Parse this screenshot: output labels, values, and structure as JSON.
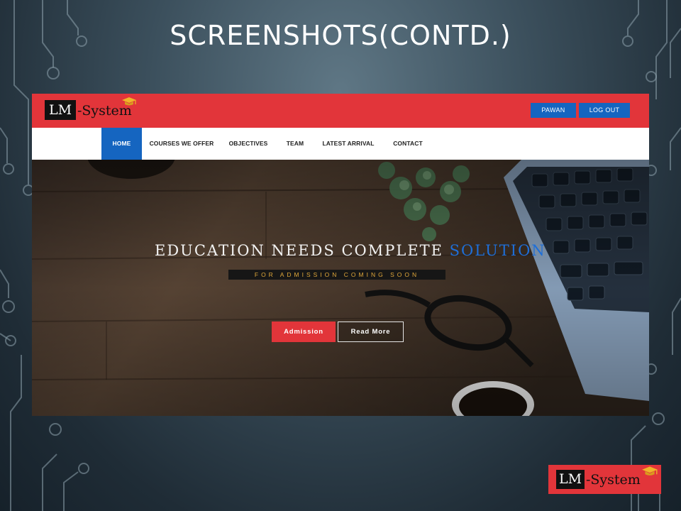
{
  "slide": {
    "title": "SCREENSHOTS(CONTD.)"
  },
  "site": {
    "logo": {
      "lm": "LM",
      "system": "-System"
    },
    "header_buttons": {
      "user": "PAWAN",
      "logout": "LOG OUT"
    },
    "nav": [
      {
        "label": "HOME",
        "active": true
      },
      {
        "label": "COURSES WE OFFER",
        "active": false
      },
      {
        "label": "OBJECTIVES",
        "active": false
      },
      {
        "label": "TEAM",
        "active": false
      },
      {
        "label": "LATEST ARRIVAL",
        "active": false
      },
      {
        "label": "CONTACT",
        "active": false
      }
    ],
    "hero": {
      "title_main": "EDUCATION NEEDS COMPLETE",
      "title_accent": "SOLUTION",
      "subtitle": "FOR ADMISSION COMING SOON",
      "admission_button": "Admission",
      "readmore_button": "Read More"
    }
  },
  "corner_logo": {
    "lm": "LM",
    "system": "-System"
  },
  "colors": {
    "brand_red": "#e2353a",
    "brand_blue": "#1565c0",
    "accent_blue": "#1e6fd9",
    "subtitle_gold": "#e0a73a"
  },
  "icons": [
    "graduation-cap-icon"
  ]
}
